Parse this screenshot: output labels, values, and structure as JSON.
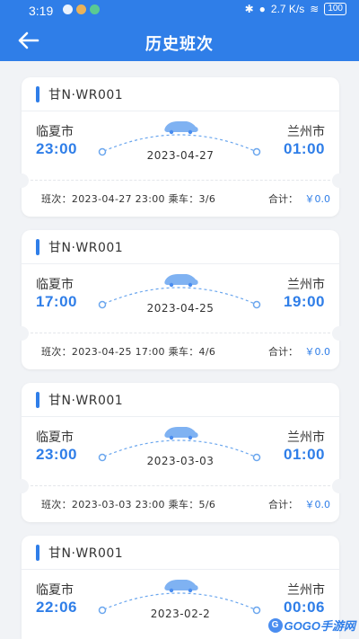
{
  "status_bar": {
    "time": "3:19",
    "signal": "2.7 K/s",
    "battery": "100"
  },
  "header": {
    "title": "历史班次"
  },
  "trips": [
    {
      "plate": "甘N·WR001",
      "from_city": "临夏市",
      "from_time": "23:00",
      "to_city": "兰州市",
      "to_time": "01:00",
      "date": "2023-04-27",
      "info": "班次：2023-04-27 23:00  乘车：3/6",
      "total_label": "合计：",
      "total": "￥0.0"
    },
    {
      "plate": "甘N·WR001",
      "from_city": "临夏市",
      "from_time": "17:00",
      "to_city": "兰州市",
      "to_time": "19:00",
      "date": "2023-04-25",
      "info": "班次：2023-04-25 17:00  乘车：4/6",
      "total_label": "合计：",
      "total": "￥0.0"
    },
    {
      "plate": "甘N·WR001",
      "from_city": "临夏市",
      "from_time": "23:00",
      "to_city": "兰州市",
      "to_time": "01:00",
      "date": "2023-03-03",
      "info": "班次：2023-03-03 23:00  乘车：5/6",
      "total_label": "合计：",
      "total": "￥0.0"
    },
    {
      "plate": "甘N·WR001",
      "from_city": "临夏市",
      "from_time": "22:06",
      "to_city": "兰州市",
      "to_time": "00:06",
      "date": "2023-02-2"
    }
  ],
  "watermark": {
    "text": "GOGO手游网"
  },
  "colors": {
    "primary": "#2f7ee8",
    "background": "#f1f3f6"
  }
}
